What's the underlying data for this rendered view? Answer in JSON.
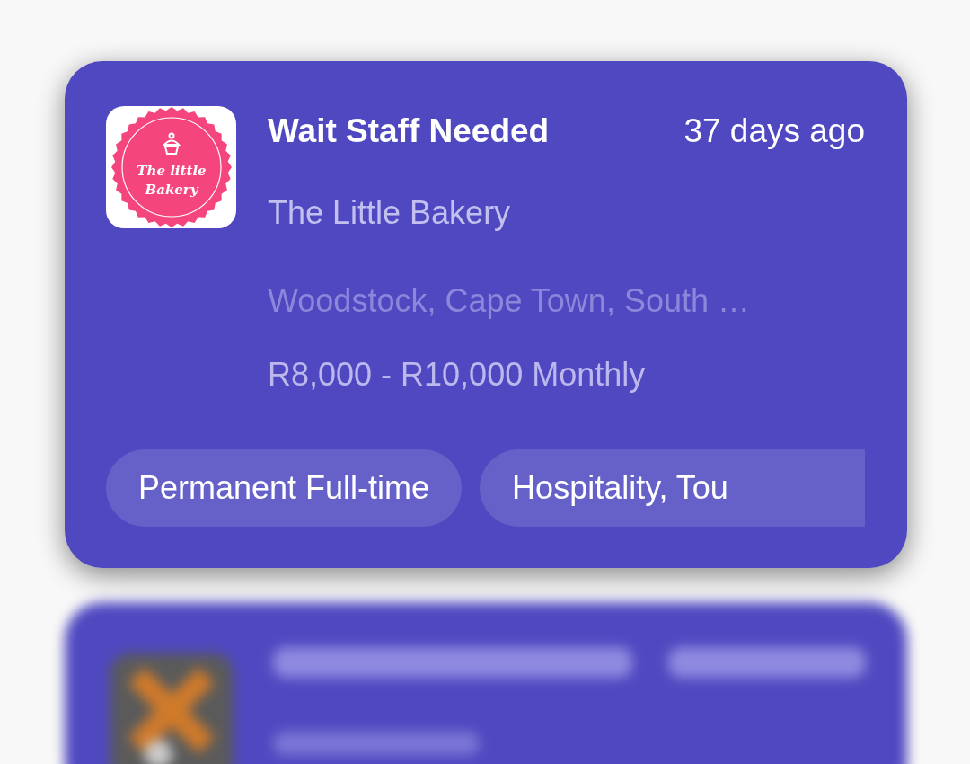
{
  "job": {
    "title": "Wait Staff Needed",
    "posted": "37 days ago",
    "company": "The Little Bakery",
    "location": "Woodstock, Cape Town, South …",
    "salary": "R8,000 - R10,000 Monthly",
    "logo_text": [
      "The little",
      "Bakery"
    ],
    "tags": [
      "Permanent Full-time",
      "Hospitality, Tou"
    ]
  },
  "next_card": {
    "blurred": true
  }
}
